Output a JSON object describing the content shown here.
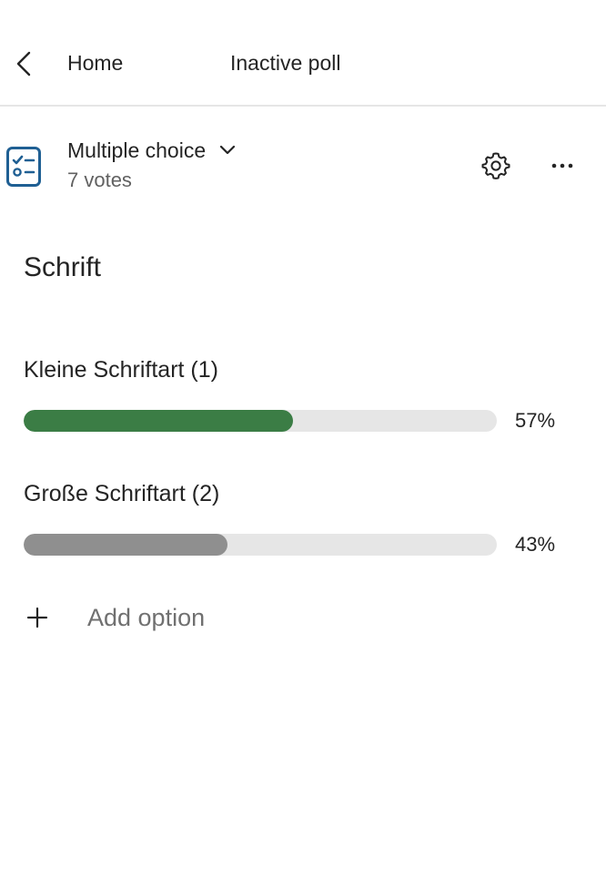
{
  "header": {
    "back_label": "Home",
    "title": "Inactive poll"
  },
  "poll": {
    "type_label": "Multiple choice",
    "votes_label": "7 votes",
    "question": "Schrift",
    "options": [
      {
        "label": "Kleine Schriftart (1)",
        "percent_text": "57%",
        "fraction": 0.57,
        "color": "#3b7d45"
      },
      {
        "label": "Große Schriftart (2)",
        "percent_text": "43%",
        "fraction": 0.43,
        "color": "#8f8f8f"
      }
    ],
    "add_option_label": "Add option"
  },
  "icons": {
    "back": "chevron-left-icon",
    "poll": "checklist-icon",
    "type_dropdown": "chevron-down-icon",
    "settings": "gear-icon",
    "more": "more-horizontal-icon",
    "add": "plus-icon"
  },
  "colors": {
    "bar_track": "#e6e6e6",
    "icon_blue": "#1f5f93"
  }
}
